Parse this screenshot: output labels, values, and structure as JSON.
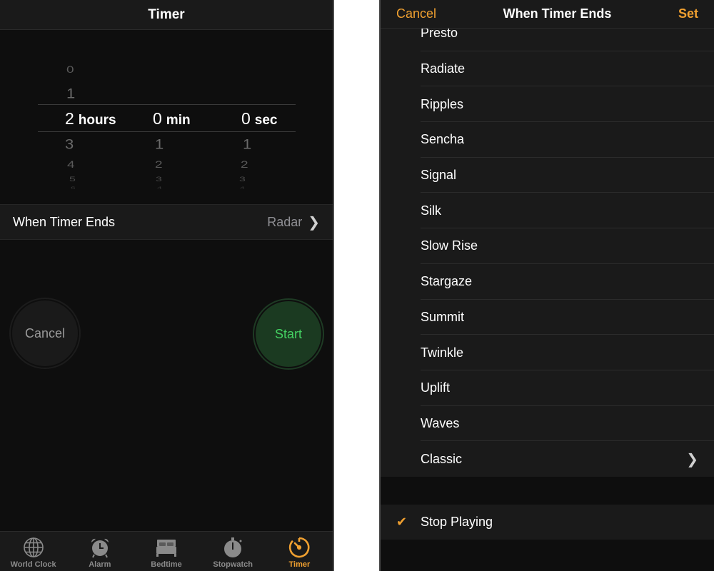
{
  "left": {
    "nav": {
      "title": "Timer"
    },
    "picker": {
      "hours": {
        "above": [
          "0",
          "1"
        ],
        "selected": "2",
        "below": [
          "3",
          "4",
          "5",
          "6"
        ],
        "unit": "hours"
      },
      "minutes": {
        "above": [],
        "selected": "0",
        "below": [
          "1",
          "2",
          "3",
          "4"
        ],
        "unit": "min"
      },
      "seconds": {
        "above": [],
        "selected": "0",
        "below": [
          "1",
          "2",
          "3",
          "4"
        ],
        "unit": "sec"
      }
    },
    "when_timer_ends": {
      "label": "When Timer Ends",
      "value": "Radar",
      "chevron": "chevron-right-icon"
    },
    "buttons": {
      "cancel": "Cancel",
      "start": "Start"
    },
    "tabbar": {
      "items": [
        {
          "label": "World Clock",
          "icon": "globe-icon",
          "active": false
        },
        {
          "label": "Alarm",
          "icon": "alarm-clock-icon",
          "active": false
        },
        {
          "label": "Bedtime",
          "icon": "bed-icon",
          "active": false
        },
        {
          "label": "Stopwatch",
          "icon": "stopwatch-icon",
          "active": false
        },
        {
          "label": "Timer",
          "icon": "timer-icon",
          "active": true
        }
      ]
    }
  },
  "right": {
    "nav": {
      "cancel": "Cancel",
      "title": "When Timer Ends",
      "set": "Set"
    },
    "sounds": [
      {
        "name": "Presto"
      },
      {
        "name": "Radiate"
      },
      {
        "name": "Ripples"
      },
      {
        "name": "Sencha"
      },
      {
        "name": "Signal"
      },
      {
        "name": "Silk"
      },
      {
        "name": "Slow Rise"
      },
      {
        "name": "Stargaze"
      },
      {
        "name": "Summit"
      },
      {
        "name": "Twinkle"
      },
      {
        "name": "Uplift"
      },
      {
        "name": "Waves"
      },
      {
        "name": "Classic",
        "has_submenu": true
      }
    ],
    "stop_playing": {
      "name": "Stop Playing",
      "selected": true,
      "check_icon": "checkmark-icon"
    }
  },
  "colors": {
    "accent": "#f0a030",
    "start_green": "#44d162",
    "start_bg": "#1b3a21",
    "background": "#0e0e0e",
    "cell": "#1a1a1a",
    "secondary_text": "#8e8e93"
  }
}
